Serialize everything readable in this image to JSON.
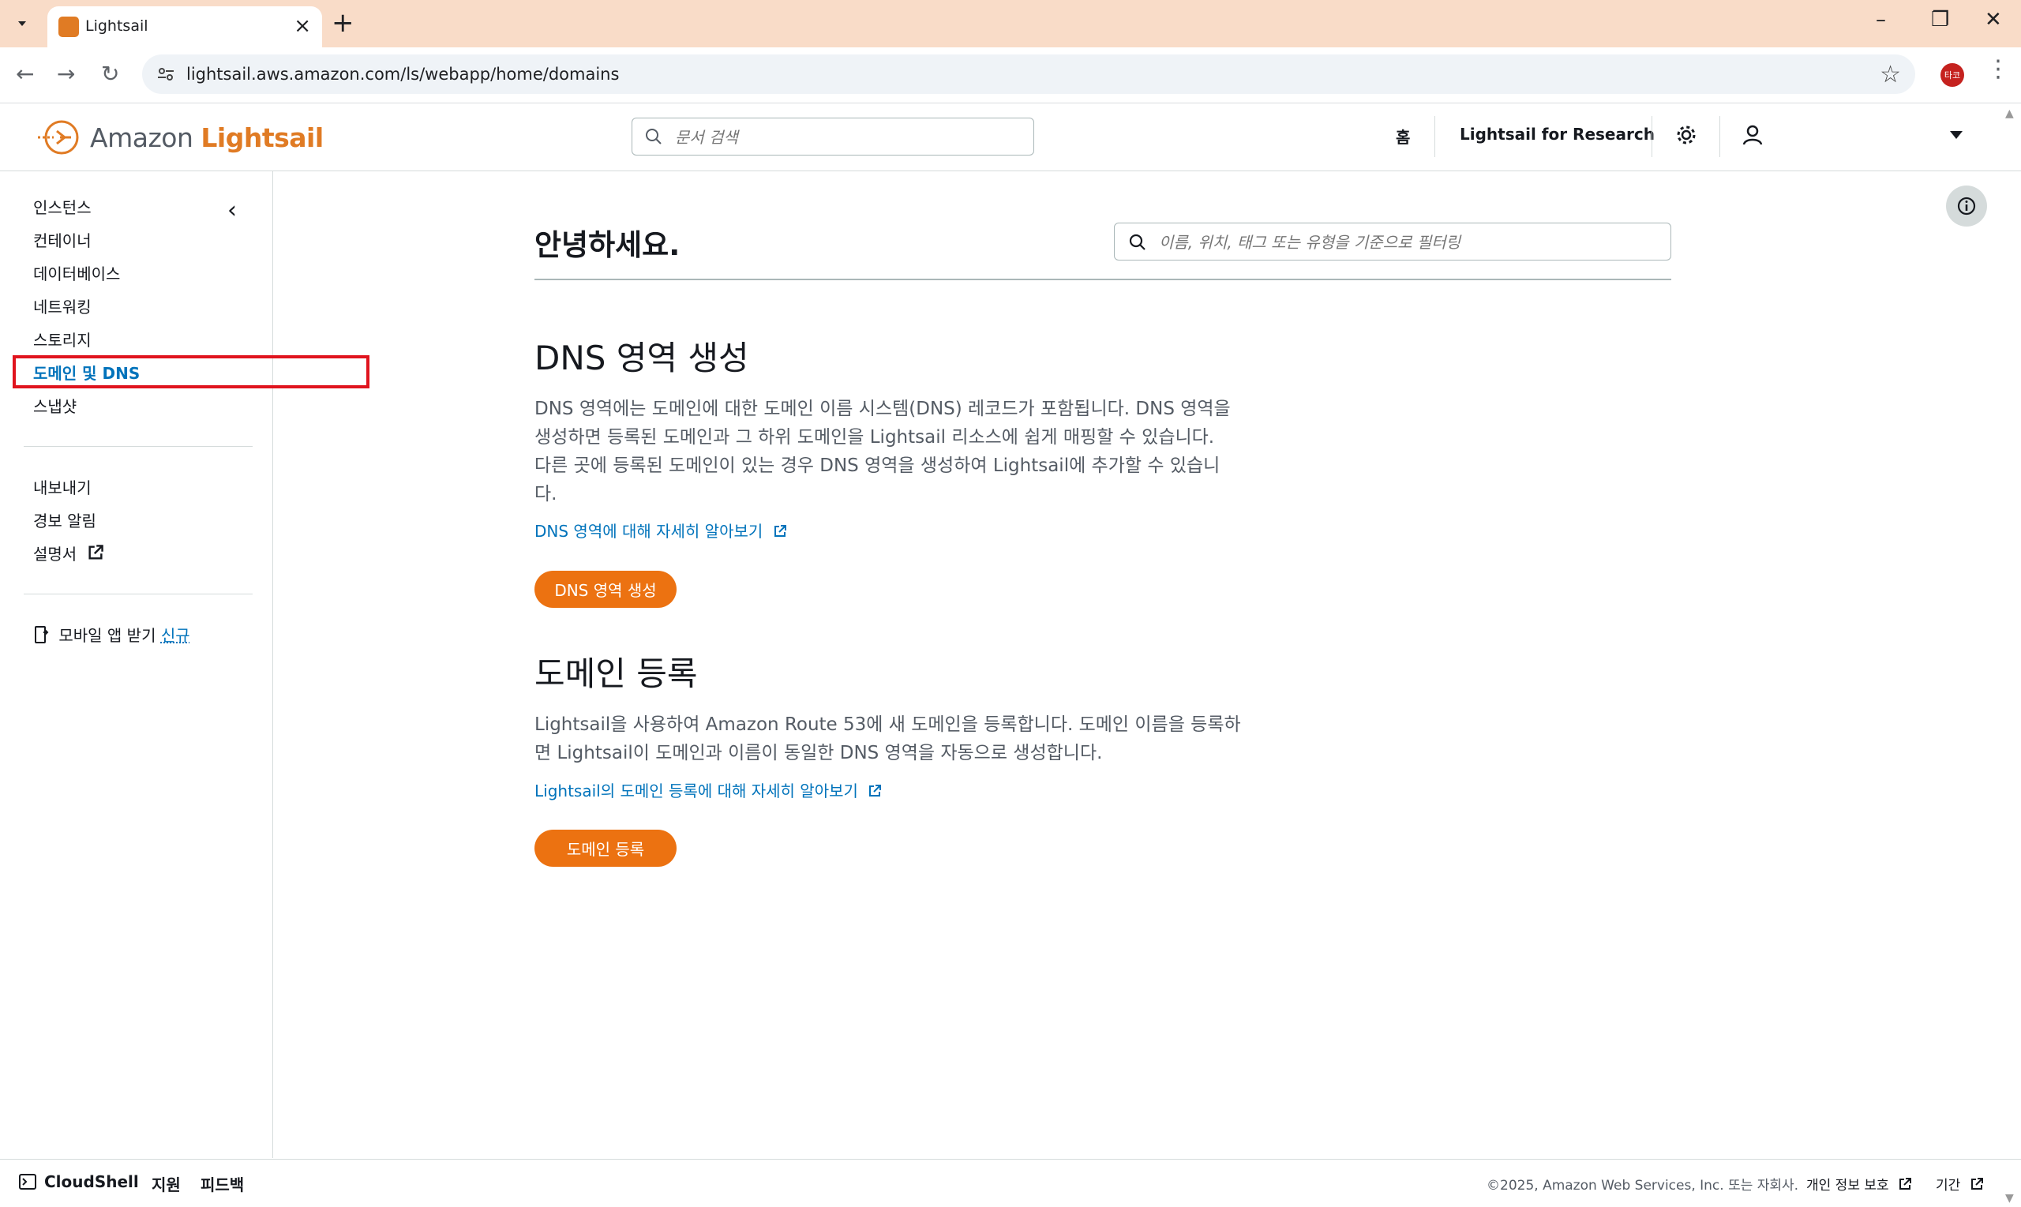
{
  "browser": {
    "tab_title": "Lightsail",
    "url": "lightsail.aws.amazon.com/ls/webapp/home/domains",
    "profile_initials": "타코"
  },
  "header": {
    "brand_amazon": "Amazon",
    "brand_product": "Lightsail",
    "search_placeholder": "문서 검색",
    "home_label": "홈",
    "research_label": "Lightsail for Research"
  },
  "sidebar": {
    "items": [
      {
        "label": "인스턴스"
      },
      {
        "label": "컨테이너"
      },
      {
        "label": "데이터베이스"
      },
      {
        "label": "네트워킹"
      },
      {
        "label": "스토리지"
      },
      {
        "label": "도메인 및 DNS"
      },
      {
        "label": "스냅샷"
      }
    ],
    "secondary": [
      {
        "label": "내보내기"
      },
      {
        "label": "경보 알림"
      },
      {
        "label": "설명서"
      }
    ],
    "mobile_app_label": "모바일 앱 받기",
    "mobile_app_badge": "신규"
  },
  "main": {
    "greeting": "안녕하세요.",
    "filter_placeholder": "이름, 위치, 태그 또는 유형을 기준으로 필터링",
    "dns": {
      "title": "DNS 영역 생성",
      "line1": "DNS 영역에는 도메인에 대한 도메인 이름 시스템(DNS) 레코드가 포함됩니다. DNS 영역을",
      "line2": "생성하면 등록된 도메인과 그 하위 도메인을 Lightsail 리소스에 쉽게 매핑할 수 있습니다.",
      "line3": "다른 곳에 등록된 도메인이 있는 경우 DNS 영역을 생성하여 Lightsail에 추가할 수 있습니",
      "line4": "다.",
      "link": "DNS 영역에 대해 자세히 알아보기",
      "button": "DNS 영역 생성"
    },
    "domain": {
      "title": "도메인 등록",
      "line1": "Lightsail을 사용하여 Amazon Route 53에 새 도메인을 등록합니다. 도메인 이름을 등록하",
      "line2": "면 Lightsail이 도메인과 이름이 동일한 DNS 영역을 자동으로 생성합니다.",
      "link": "Lightsail의 도메인 등록에 대해 자세히 알아보기",
      "button": "도메인 등록"
    }
  },
  "footer": {
    "cloudshell": "CloudShell",
    "support": "지원",
    "feedback": "피드백",
    "copyright": "©2025, Amazon Web Services, Inc. 또는 자회사.",
    "privacy": "개인 정보 보호",
    "terms": "기간"
  },
  "colors": {
    "accent_orange": "#ec7211",
    "link_blue": "#0073bb",
    "highlight_red": "#e0141e"
  }
}
